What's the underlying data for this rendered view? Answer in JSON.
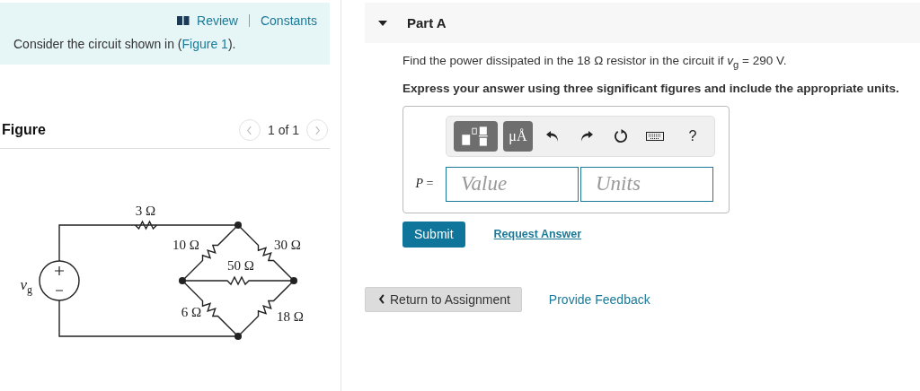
{
  "intro": {
    "review": "Review",
    "constants": "Constants",
    "sentence": "Consider the circuit shown in (",
    "link": "Figure 1",
    "sentence_end": ")."
  },
  "figure": {
    "title": "Figure",
    "pager": "1 of 1",
    "prev_disabled": true,
    "next_disabled": true,
    "labels": [
      {
        "text": "3 Ω"
      },
      {
        "text": "10 Ω"
      },
      {
        "text": "30 Ω"
      },
      {
        "text": "50 Ω"
      },
      {
        "text": "6 Ω"
      },
      {
        "text": "18 Ω"
      }
    ],
    "source": {
      "symbol": "v",
      "subscript": "g"
    }
  },
  "part": {
    "title": "Part A",
    "expanded": true,
    "prompt": "Find the power dissipated in the 18 Ω resistor in the circuit if *v*$_{g}$ = 290 V.",
    "instruction": "Express your answer using three significant figures and include the appropriate units.",
    "toolbar": [
      {
        "kind": "templates"
      },
      {
        "kind": "units",
        "label": "μÅ"
      },
      {
        "kind": "undo"
      },
      {
        "kind": "redo"
      },
      {
        "kind": "reset"
      },
      {
        "kind": "keyboard"
      },
      {
        "kind": "help",
        "label": "?"
      }
    ],
    "variable": "P",
    "equals": "=",
    "value_placeholder": "Value",
    "units_placeholder": "Units",
    "submit": "Submit",
    "request": "Request Answer"
  },
  "footer": {
    "back": "Return to Assignment",
    "feedback": "Provide Feedback"
  }
}
